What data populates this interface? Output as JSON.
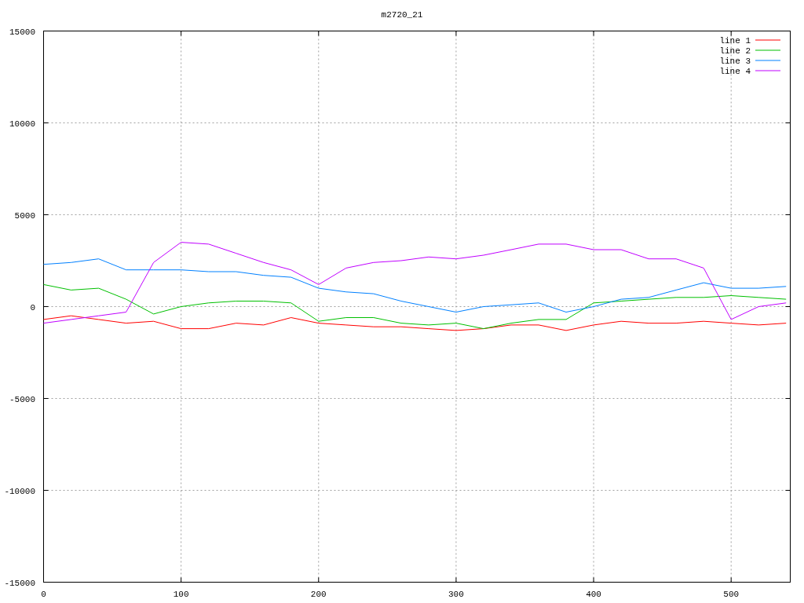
{
  "plot": {
    "chart_data": {
      "type": "line",
      "title": "m2720_21",
      "x": [
        0,
        20,
        40,
        60,
        80,
        100,
        120,
        140,
        160,
        180,
        200,
        220,
        240,
        260,
        280,
        300,
        320,
        340,
        360,
        380,
        400,
        420,
        440,
        460,
        480,
        500,
        520,
        540
      ],
      "series": [
        {
          "name": "line 1",
          "color": "#ff0000",
          "values": [
            -700,
            -500,
            -700,
            -900,
            -800,
            -1200,
            -1200,
            -900,
            -1000,
            -600,
            -900,
            -1000,
            -1100,
            -1100,
            -1200,
            -1300,
            -1200,
            -1000,
            -1000,
            -1300,
            -1000,
            -800,
            -900,
            -900,
            -800,
            -900,
            -1000,
            -900
          ]
        },
        {
          "name": "line 2",
          "color": "#00c000",
          "values": [
            1200,
            900,
            1000,
            400,
            -400,
            0,
            200,
            300,
            300,
            200,
            -800,
            -600,
            -600,
            -900,
            -1000,
            -900,
            -1200,
            -900,
            -700,
            -700,
            200,
            300,
            400,
            500,
            500,
            600,
            500,
            400
          ]
        },
        {
          "name": "line 3",
          "color": "#0080ff",
          "values": [
            2300,
            2400,
            2600,
            2000,
            2000,
            2000,
            1900,
            1900,
            1700,
            1600,
            1000,
            800,
            700,
            300,
            0,
            -300,
            0,
            100,
            200,
            -300,
            0,
            400,
            500,
            900,
            1300,
            1000,
            1000,
            1100
          ]
        },
        {
          "name": "line 4",
          "color": "#c000ff",
          "values": [
            -900,
            -700,
            -500,
            -300,
            2400,
            3500,
            3400,
            2900,
            2400,
            2000,
            1200,
            2100,
            2400,
            2500,
            2700,
            2600,
            2800,
            3100,
            3400,
            3400,
            3100,
            3100,
            2600,
            2600,
            2100,
            -700,
            0,
            200
          ]
        }
      ],
      "grid": true,
      "legend": true,
      "xlim": [
        0,
        543
      ],
      "ylim": [
        -15000,
        15000
      ],
      "xticks": [
        0,
        100,
        200,
        300,
        400,
        500
      ],
      "yticks": [
        -15000,
        -10000,
        -5000,
        0,
        5000,
        10000,
        15000
      ]
    }
  }
}
